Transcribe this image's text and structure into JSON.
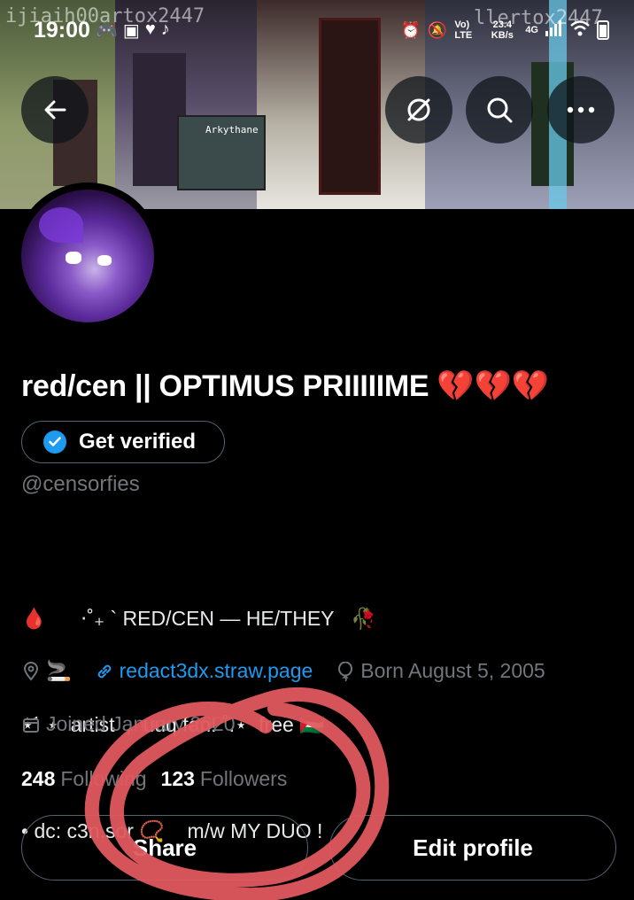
{
  "status_bar": {
    "time": "19:00",
    "network_lte": "Vo) LTE",
    "data_rate": "23.4 KB/s",
    "network_gen": "4G"
  },
  "banner": {
    "overlay_text_left": "ijiaih00artox2447",
    "overlay_text_right": "llertox2447",
    "sign_text": "Arkythane"
  },
  "header_actions": {
    "back": "back-arrow-icon",
    "grok": "slash-circle-icon",
    "search": "search-icon",
    "more": "more-dots-icon"
  },
  "profile": {
    "display_name": "red/cen || OPTIMUS PRIIIIIME",
    "display_name_emoji": "💔💔💔",
    "verify_button": "Get verified",
    "handle": "@censorfies",
    "bio_lines": [
      "🩸      ⋅˚₊ ` RED/CEN — HE/THEY   🥀",
      "⋆˙ ⋆  artist  ,  uuq fan! ˚.⋆  free 🇵🇸",
      "• dc: c3n.sor 📿    m/w MY DUO !"
    ],
    "location_emoji": "🚬",
    "website": "redact3dx.straw.page",
    "birthday": "Born August 5, 2005",
    "joined": "Joined January 2020",
    "following_count": "248",
    "following_label": "Following",
    "followers_count": "123",
    "followers_label": "Followers",
    "share_button": "Share",
    "edit_profile_button": "Edit profile"
  },
  "colors": {
    "background": "#000000",
    "text_primary": "#e7e9ea",
    "text_secondary": "#71767b",
    "link": "#1d9bf0",
    "border": "#536471",
    "annotation": "#e0585e"
  }
}
